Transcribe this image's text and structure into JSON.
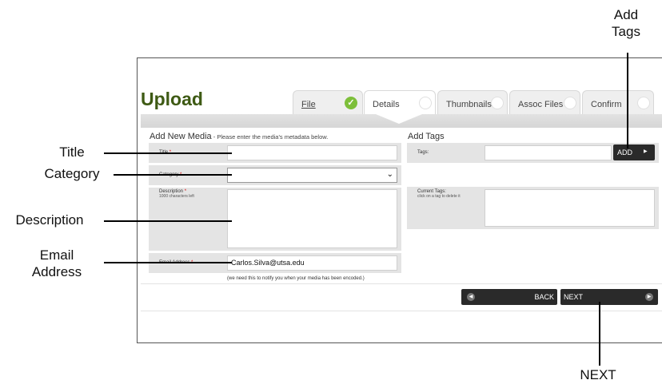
{
  "callouts": {
    "add_tags_1": "Add",
    "add_tags_2": "Tags",
    "title": "Title",
    "category": "Category",
    "description": "Description",
    "email_1": "Email",
    "email_2": "Address",
    "next": "NEXT"
  },
  "page": {
    "title": "Upload"
  },
  "tabs": [
    {
      "label": "File",
      "status": "complete"
    },
    {
      "label": "Details",
      "status": "active"
    },
    {
      "label": "Thumbnails",
      "status": "pending"
    },
    {
      "label": "Assoc Files",
      "status": "pending"
    },
    {
      "label": "Confirm",
      "status": "pending"
    }
  ],
  "media_form": {
    "heading": "Add New Media",
    "heading_sub": " - Please enter the media's metadata below.",
    "title_label": "Title",
    "category_label": "Category",
    "description_label": "Description",
    "description_counter": "1000 characters left",
    "email_label": "Email Address",
    "email_value": "Carlos.Silva@utsa.edu",
    "email_note": "(we need this to notify you when your media has been encoded.)",
    "required_marker": "*"
  },
  "tags_form": {
    "heading": "Add Tags",
    "tags_label": "Tags:",
    "add_button": "ADD",
    "current_tags_label": "Current Tags:",
    "current_tags_hint": "click on a tag to delete it"
  },
  "nav": {
    "back_label": "BACK",
    "next_label": "NEXT"
  },
  "colors": {
    "brand": "#3e5a14",
    "check": "#7dbf3a",
    "button": "#2a2a2a",
    "required": "#dd0000"
  }
}
